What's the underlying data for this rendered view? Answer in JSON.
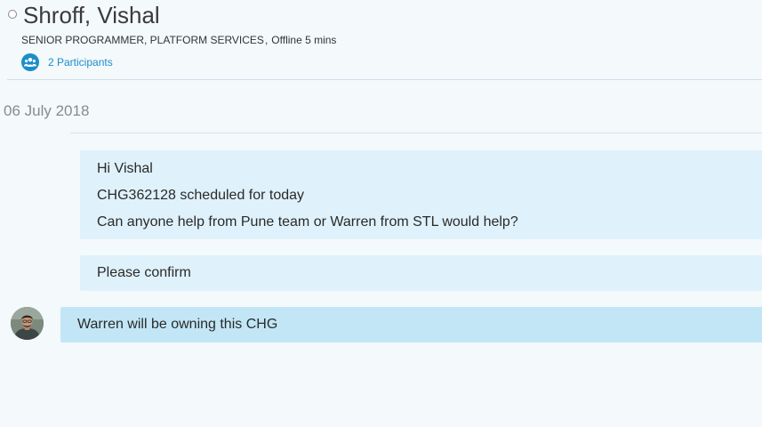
{
  "header": {
    "contact_name": "Shroff, Vishal",
    "job_title": "SENIOR PROGRAMMER, PLATFORM SERVICES",
    "separator": ",",
    "presence": "Offline 5 mins",
    "participants_label": "2 Participants",
    "participants_icon": "participants-icon",
    "status_icon": "offline-status-icon",
    "accent_color": "#1b8ec9"
  },
  "conversation": {
    "date": "06 July 2018",
    "messages": [
      {
        "direction": "outgoing",
        "lines": [
          "Hi Vishal",
          "CHG362128 scheduled for today",
          "Can anyone help from Pune team or Warren from STL would help?"
        ]
      },
      {
        "direction": "outgoing",
        "lines": [
          "Please confirm"
        ]
      },
      {
        "direction": "incoming",
        "avatar": "contact-avatar",
        "lines": [
          "Warren will be owning this CHG"
        ]
      }
    ]
  },
  "colors": {
    "background": "#f4f9fc",
    "outgoing_bubble": "#dff1fa",
    "incoming_bubble": "#c2e6f6"
  }
}
